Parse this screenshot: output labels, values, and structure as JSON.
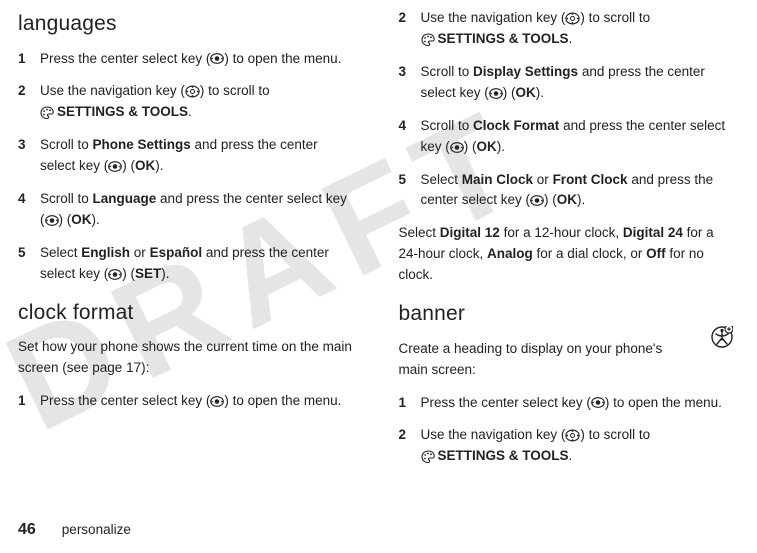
{
  "watermark": "DRAFT",
  "left": {
    "heading1": "languages",
    "steps1": [
      {
        "n": "1",
        "pre": "Press the center select key (",
        "post": ") to open the menu.",
        "icon": "center"
      },
      {
        "n": "2",
        "pre": "Use the navigation key (",
        "post": ") to scroll to ",
        "icon": "nav",
        "tail_icon": "palette",
        "tail_bold": "SETTINGS & TOOLS",
        "tail_after": "."
      },
      {
        "n": "3",
        "pre": "Scroll to ",
        "bold1": "Phone Settings",
        "mid": " and press the center select key (",
        "icon_mid": "center",
        "after_icon": ") (",
        "bold2": "OK",
        "end": ")."
      },
      {
        "n": "4",
        "pre": "Scroll to ",
        "bold1": "Language",
        "mid": " and press the center select key (",
        "icon_mid": "center",
        "after_icon": ") (",
        "bold2": "OK",
        "end": ")."
      },
      {
        "n": "5",
        "pre": "Select ",
        "bold1": "English",
        "mid1": " or ",
        "bold1b": "Español",
        "mid": " and press the center select key (",
        "icon_mid": "center",
        "after_icon": ") (",
        "bold2": "SET",
        "end": ")."
      }
    ],
    "heading2": "clock format",
    "para": "Set how your phone shows the current time on the main screen (see page 17):",
    "steps2": [
      {
        "n": "1",
        "pre": "Press the center select key (",
        "post": ") to open the menu.",
        "icon": "center"
      }
    ]
  },
  "right": {
    "steps_top": [
      {
        "n": "2",
        "pre": "Use the navigation key (",
        "post": ") to scroll to ",
        "icon": "nav",
        "tail_icon": "palette",
        "tail_bold": "SETTINGS & TOOLS",
        "tail_after": "."
      },
      {
        "n": "3",
        "pre": "Scroll to ",
        "bold1": "Display Settings",
        "mid": " and press the center select key (",
        "icon_mid": "center",
        "after_icon": ") (",
        "bold2": "OK",
        "end": ")."
      },
      {
        "n": "4",
        "pre": "Scroll to ",
        "bold1": "Clock Format",
        "mid": " and press the center select key (",
        "icon_mid": "center",
        "after_icon": ") (",
        "bold2": "OK",
        "end": ")."
      },
      {
        "n": "5",
        "pre": "Select ",
        "bold1": "Main Clock",
        "mid1": " or ",
        "bold1b": "Front Clock",
        "mid": " and press the center select key (",
        "icon_mid": "center",
        "after_icon": ") (",
        "bold2": "OK",
        "end": ")."
      }
    ],
    "clock_para": {
      "p1": "Select ",
      "b1": "Digital 12",
      "p2": " for a 12-hour clock, ",
      "b2": "Digital 24",
      "p3": " for a 24-hour clock, ",
      "b3": "Analog",
      "p4": " for a dial clock, or ",
      "b4": "Off",
      "p5": " for no clock."
    },
    "heading": "banner",
    "banner_para": "Create a heading to display on your phone's main screen:",
    "steps_bottom": [
      {
        "n": "1",
        "pre": "Press the center select key (",
        "post": ") to open the menu.",
        "icon": "center"
      },
      {
        "n": "2",
        "pre": "Use the navigation key (",
        "post": ") to scroll to ",
        "icon": "nav",
        "tail_icon": "palette",
        "tail_bold": "SETTINGS & TOOLS",
        "tail_after": "."
      }
    ]
  },
  "footer": {
    "page": "46",
    "chapter": "personalize"
  }
}
